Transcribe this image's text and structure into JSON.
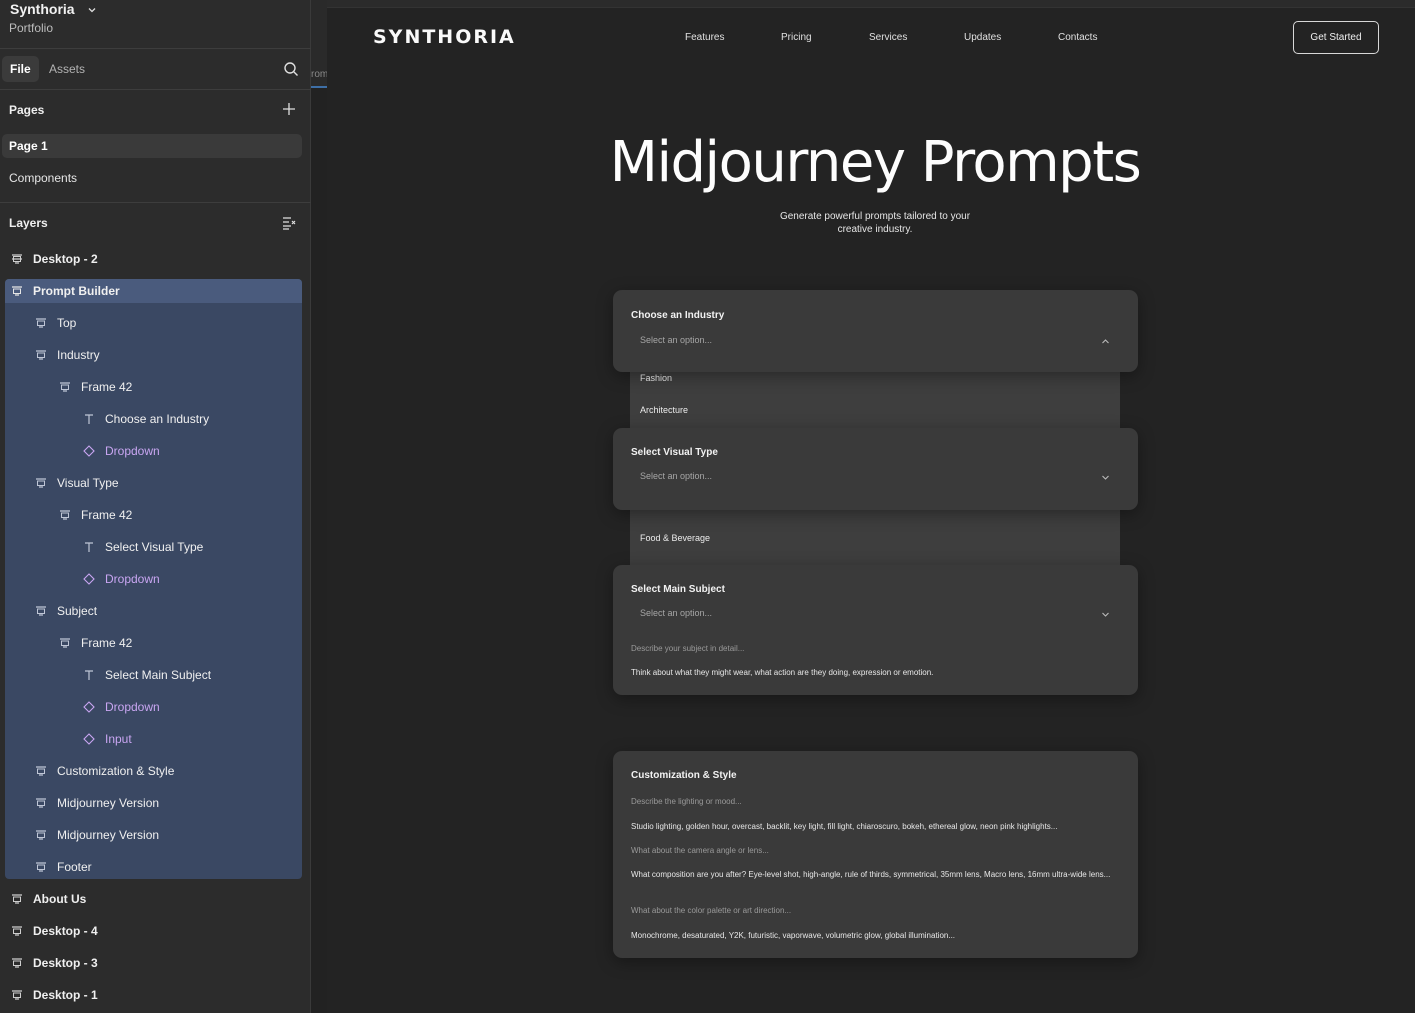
{
  "sidebar": {
    "project_name": "Synthoria",
    "project_sub": "Portfolio",
    "tabs": {
      "file": "File",
      "assets": "Assets"
    },
    "pages_title": "Pages",
    "pages": [
      "Page 1",
      "Components"
    ],
    "layers_title": "Layers",
    "layers": [
      "Desktop - 2",
      "Prompt Builder",
      "Top",
      "Industry",
      "Frame 42",
      "Choose an Industry",
      "Dropdown",
      "Visual Type",
      "Frame 42",
      "Select Visual Type",
      "Dropdown",
      "Subject",
      "Frame 42",
      "Select Main Subject",
      "Dropdown",
      "Input",
      "Customization & Style",
      "Midjourney Version",
      "Midjourney Version",
      "Footer",
      "About Us",
      "Desktop - 4",
      "Desktop - 3",
      "Desktop - 1"
    ]
  },
  "strip_text": "rom",
  "site": {
    "logo": "SYNTHORIA",
    "nav": [
      "Features",
      "Pricing",
      "Services",
      "Updates",
      "Contacts"
    ],
    "cta": "Get Started",
    "title": "Midjourney Prompts",
    "subtitle": "Generate powerful prompts tailored to your creative industry.",
    "industry": {
      "label": "Choose an Industry",
      "placeholder": "Select an option...",
      "options": [
        "Fashion",
        "Architecture"
      ]
    },
    "visual": {
      "label": "Select Visual Type",
      "placeholder": "Select an option...",
      "options": [
        "Food & Beverage"
      ]
    },
    "subject": {
      "label": "Select Main Subject",
      "placeholder": "Select an option...",
      "detail_hint": "Describe your subject in detail...",
      "detail_text": "Think about what they might wear, what action are they doing, expression or emotion."
    },
    "style": {
      "label": "Customization & Style",
      "lighting_hint": "Describe the lighting or mood...",
      "lighting_text": "Studio lighting, golden hour, overcast, backlit, key light, fill light, chiaroscuro, bokeh, ethereal glow, neon pink highlights...",
      "camera_hint": "What about the camera angle or lens...",
      "camera_text": "What composition are you after? Eye-level shot, high-angle, rule of thirds, symmetrical, 35mm lens, Macro lens, 16mm ultra-wide lens...",
      "color_hint": "What about the color palette or art direction...",
      "color_text": "Monochrome, desaturated, Y2K, futuristic, vaporwave, volumetric glow, global illumination..."
    }
  },
  "colors": {
    "selection": "#3a4863",
    "component": "#c9a6f2",
    "canvas": "#232323",
    "card": "#3a3a3a"
  }
}
